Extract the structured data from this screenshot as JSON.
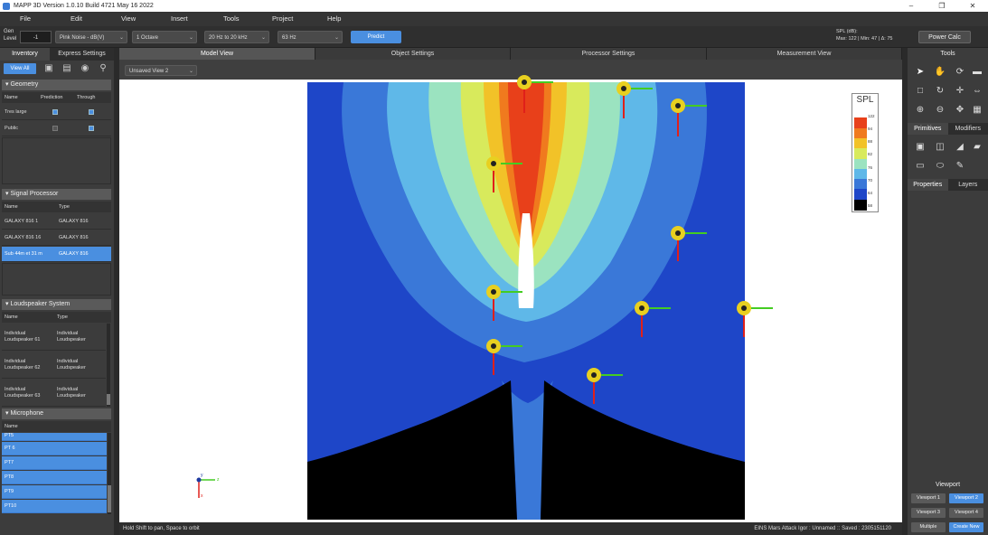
{
  "window": {
    "title": "MAPP 3D Version 1.0.10 Build 4721 May 16 2022",
    "min_icon": "minimize-icon",
    "max_icon": "restore-icon",
    "close_icon": "close-icon"
  },
  "menu": [
    "File",
    "Edit",
    "View",
    "Insert",
    "Tools",
    "Project",
    "Help"
  ],
  "toolbar": {
    "gen_label_1": "Gen",
    "gen_label_2": "Level",
    "gen_value": "-1",
    "signal": "Pink Noise - dB(V)",
    "bandwidth": "1 Octave",
    "range": "20 Hz to 20 kHz",
    "freq": "63 Hz",
    "predict": "Predict",
    "spl_title": "SPL (dB):",
    "spl_stats": "Max: 122 | Min: 47 | Δ: 75",
    "power_calc": "Power Calc"
  },
  "left": {
    "tabs": [
      "Inventory",
      "Express Settings"
    ],
    "view_all": "View All",
    "geometry": {
      "title": "Geometry",
      "cols": [
        "Name",
        "Prediction",
        "Through"
      ],
      "rows": [
        {
          "name": "Tres large",
          "prediction": true,
          "through": true
        },
        {
          "name": "Public",
          "prediction": false,
          "through": true
        }
      ]
    },
    "signal_processor": {
      "title": "Signal Processor",
      "cols": [
        "Name",
        "Type"
      ],
      "rows": [
        {
          "name": "GALAXY 816 1",
          "type": "GALAXY 816"
        },
        {
          "name": "GALAXY 816 16",
          "type": "GALAXY 816"
        },
        {
          "name": "Sub 44m et 31 m",
          "type": "GALAXY 816",
          "selected": true
        }
      ]
    },
    "loudspeaker": {
      "title": "Loudspeaker System",
      "cols": [
        "Name",
        "Type"
      ],
      "rows": [
        {
          "name": "Individual Loudspeaker 61",
          "type": "Individual Loudspeaker"
        },
        {
          "name": "Individual Loudspeaker 62",
          "type": "Individual Loudspeaker"
        },
        {
          "name": "Individual Loudspeaker 63",
          "type": "Individual Loudspeaker"
        }
      ]
    },
    "microphone": {
      "title": "Microphone",
      "col": "Name",
      "rows": [
        "PT5",
        "PT 6",
        "PT7",
        "PT8",
        "PT9",
        "PT10"
      ]
    }
  },
  "center": {
    "tabs": [
      "Model View",
      "Object Settings",
      "Processor Settings",
      "Measurement View"
    ],
    "view_select": "Unsaved View 2",
    "legend_title": "SPL",
    "legend_labels": [
      "122",
      "94",
      "88",
      "82",
      "76",
      "70",
      "64",
      "58"
    ],
    "legend_colors": [
      "#ffffff",
      "#e8401a",
      "#f07a1e",
      "#f2c228",
      "#d8ea5c",
      "#9be3c0",
      "#5fb8e8",
      "#3a78d8",
      "#1e46c8",
      "#000000"
    ],
    "axes": {
      "y": "y",
      "z": "z",
      "x": "x"
    },
    "status_left": "Hold Shift to pan, Space to orbit",
    "status_right": "EINS Mars Attack Igor : Unnamed :: Saved : 2305151120"
  },
  "right": {
    "title": "Tools",
    "tools": [
      "select-arrow-icon",
      "hand-pan-icon",
      "orbit-icon",
      "measure-icon",
      "frame-icon",
      "rotate-icon",
      "zoom-axis-icon",
      "flip-icon",
      "zoom-in-icon",
      "zoom-out-icon",
      "move-icon",
      "grid-icon"
    ],
    "tabs_a": [
      "Primitives",
      "Modifiers"
    ],
    "primitives": [
      "cube-icon",
      "cylinder-icon",
      "cone-icon",
      "surface-icon",
      "rectangle-icon",
      "ellipse-icon",
      "pen-icon"
    ],
    "tabs_b": [
      "Properties",
      "Layers"
    ],
    "viewport_title": "Viewport",
    "viewports": [
      "Viewport 1",
      "Viewport 2",
      "Viewport 3",
      "Viewport 4",
      "Multiple",
      "Create New"
    ],
    "viewport_active": [
      1,
      5
    ]
  }
}
